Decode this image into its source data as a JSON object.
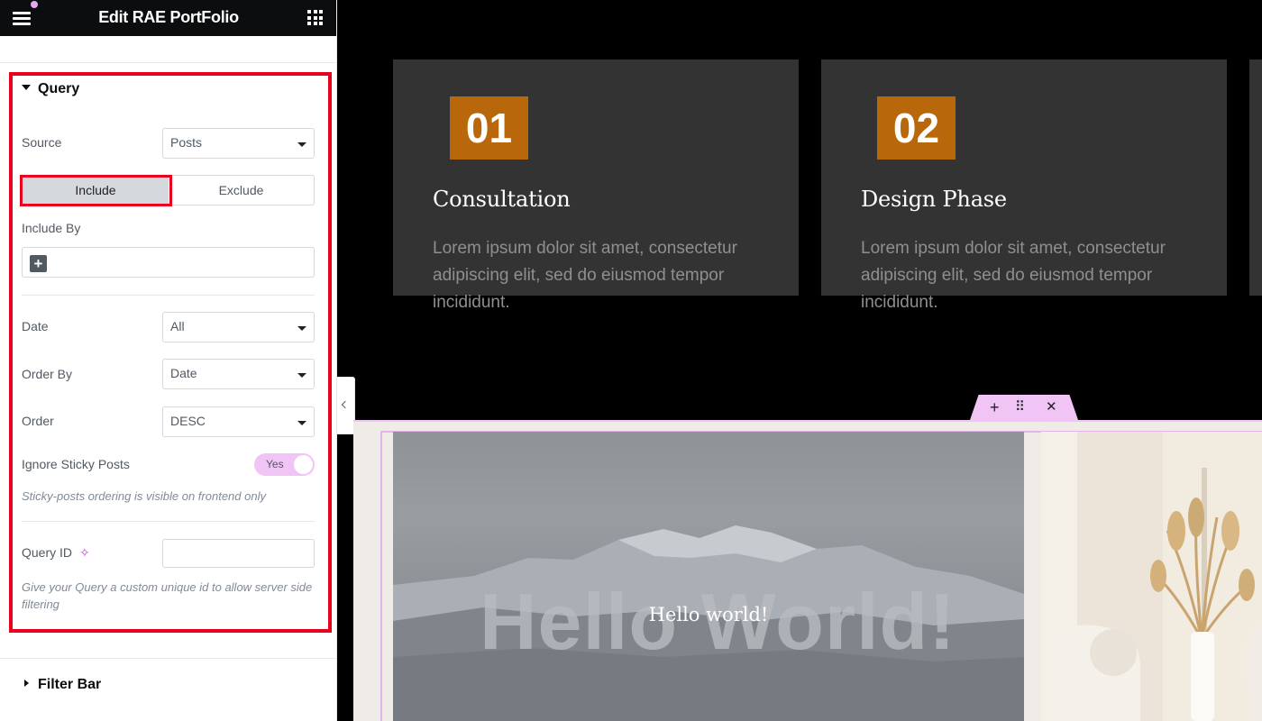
{
  "topbar": {
    "title": "Edit RAE PortFolio"
  },
  "query": {
    "heading": "Query",
    "source": {
      "label": "Source",
      "value": "Posts"
    },
    "tabs": {
      "include": "Include",
      "exclude": "Exclude",
      "active": "Include"
    },
    "include_by": {
      "label": "Include By"
    },
    "date": {
      "label": "Date",
      "value": "All"
    },
    "order_by": {
      "label": "Order By",
      "value": "Date"
    },
    "order": {
      "label": "Order",
      "value": "DESC"
    },
    "ignore_sticky": {
      "label": "Ignore Sticky Posts",
      "toggle": "Yes",
      "note": "Sticky-posts ordering is visible on frontend only"
    },
    "query_id": {
      "label": "Query ID",
      "value": "",
      "note": "Give your Query a custom unique id to allow server side filtering"
    }
  },
  "filter_bar": {
    "heading": "Filter Bar"
  },
  "preview": {
    "cards": [
      {
        "number": "01",
        "title": "Consultation",
        "text": "Lorem ipsum dolor sit amet, consectetur adipiscing elit, sed do eiusmod tempor incididunt."
      },
      {
        "number": "02",
        "title": "Design Phase",
        "text": "Lorem ipsum dolor sit amet, consectetur adipiscing elit, sed do eiusmod tempor incididunt."
      }
    ],
    "image_text_large": "Hello World!",
    "image_caption": "Hello world!",
    "handle": {
      "add": "+",
      "move": "⠿",
      "close": "✕"
    }
  },
  "colors": {
    "accent": "#f0c4f5",
    "highlight": "#e8001c",
    "number_bg": "#b8680a",
    "card_bg": "#333333"
  }
}
